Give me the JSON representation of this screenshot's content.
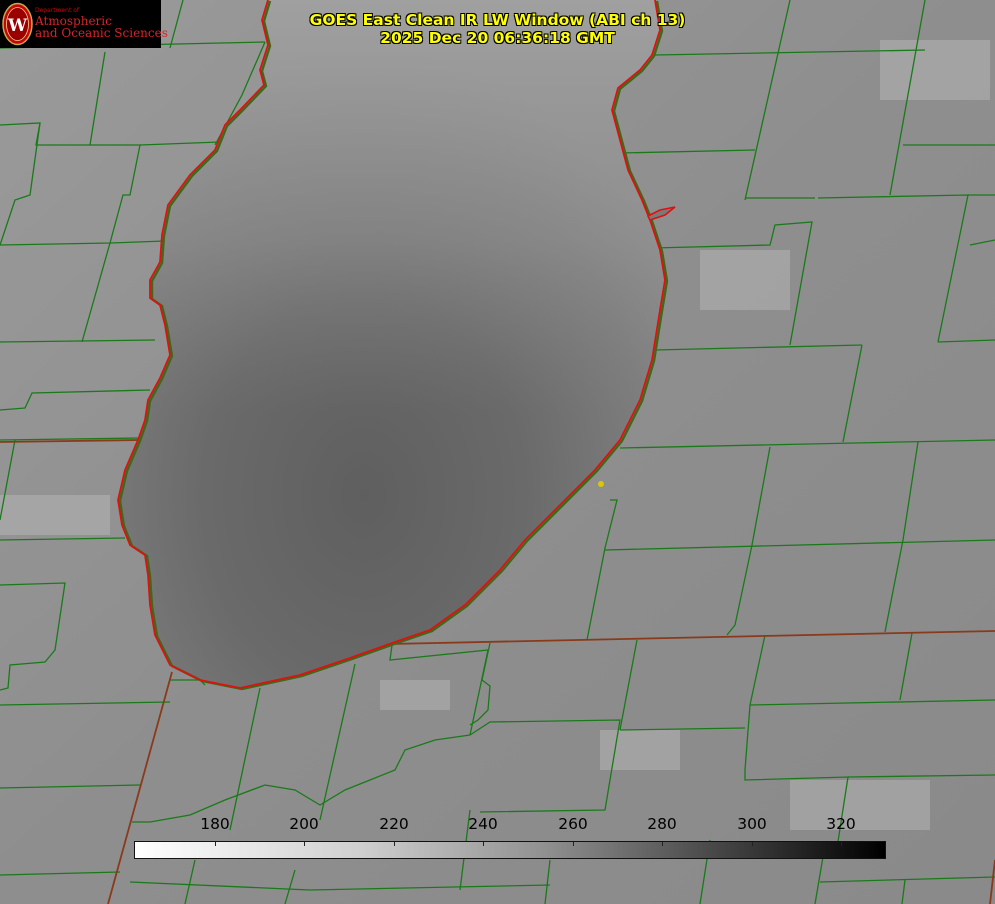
{
  "header": {
    "title_line1": "GOES East Clean IR LW Window (ABI ch 13)",
    "title_line2": "2025 Dec 20 06:36:18 GMT"
  },
  "logo": {
    "dept_text": "Department of",
    "line1": "Atmospheric",
    "line2": "and Oceanic Sciences",
    "seal_letter": "W"
  },
  "colorbar": {
    "ticks": [
      "180",
      "200",
      "220",
      "240",
      "260",
      "280",
      "300",
      "320"
    ],
    "min_color": "#ffffff",
    "max_color": "#000000"
  },
  "map_colors": {
    "county_lines": "#1a7a1a",
    "state_lines": "#8a3a1a",
    "lake_outline": "#e01010",
    "marker": "#d8c800"
  }
}
